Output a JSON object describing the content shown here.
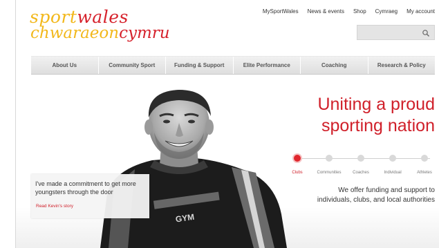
{
  "logo": {
    "line1_part1": "sport",
    "line1_part2": "wales",
    "line2_part1": "chwaraeon",
    "line2_part2": "cymru",
    "colors": {
      "yellow": "#f2b81c",
      "red": "#d6222c"
    }
  },
  "utility_nav": [
    "MySportWales",
    "News & events",
    "Shop",
    "Cymraeg",
    "My account"
  ],
  "search": {
    "value": "",
    "icon": "search-icon"
  },
  "main_nav": [
    "About Us",
    "Community Sport",
    "Funding & Support",
    "Elite Performance",
    "Coaching",
    "Research & Policy"
  ],
  "hero": {
    "headline_line1": "Uniting a proud",
    "headline_line2": "sporting nation",
    "slider": {
      "items": [
        "Clubs",
        "Communities",
        "Coaches",
        "Individual",
        "Athletes"
      ],
      "active_index": 0
    },
    "tagline_line1": "We offer funding and support to",
    "tagline_line2": "individuals, clubs, and local authorities",
    "shirt_text": "GYM",
    "quote": {
      "text": "I've made a commitment to get more youngsters through the door",
      "link": "Read Kevin's story"
    }
  },
  "colors": {
    "accent": "#d0202a",
    "nav_bg": "#e6e6e6"
  }
}
